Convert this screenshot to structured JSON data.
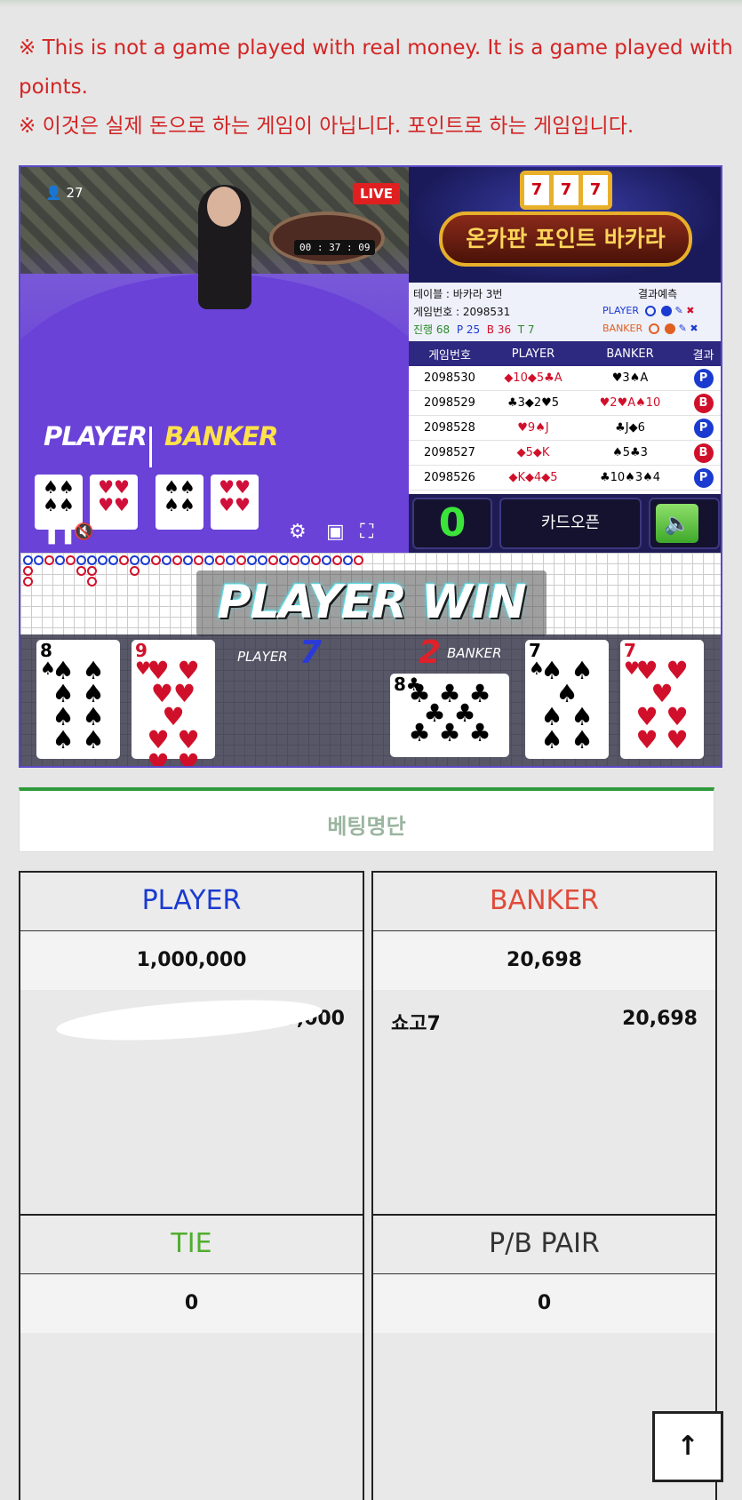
{
  "notice": {
    "line1": "※ This is not a game played with real money. It is a game played with",
    "line2": "points.",
    "line3": "※ 이것은 실제 돈으로 하는 게임이 아닙니다. 포인트로 하는 게임입니다."
  },
  "video": {
    "viewers": "27",
    "live_label": "LIVE",
    "timer": "00 : 37 : 09",
    "player_label": "PLAYER",
    "banker_label": "BANKER"
  },
  "board": {
    "logo": "온카판 포인트 바카라",
    "slot": [
      "7",
      "7",
      "7"
    ],
    "table_label": "테이블 : 바카라 3번",
    "game_no_label": "게임번호 : 2098531",
    "progress_label": "진행 68",
    "p_count": "P 25",
    "b_count": "B 36",
    "t_count": "T 7",
    "prediction_label": "결과예측",
    "pred_player": "PLAYER",
    "pred_banker": "BANKER",
    "history_headers": [
      "게임번호",
      "PLAYER",
      "BANKER",
      "결과"
    ],
    "history": [
      {
        "no": "2098530",
        "player": "◆10◆5♣A",
        "banker": "♥3♠A",
        "result": "P"
      },
      {
        "no": "2098529",
        "player": "♣3◆2♥5",
        "banker": "♥2♥A♠10",
        "result": "B"
      },
      {
        "no": "2098528",
        "player": "♥9♠J",
        "banker": "♣J◆6",
        "result": "P"
      },
      {
        "no": "2098527",
        "player": "◆5◆K",
        "banker": "♠5♣3",
        "result": "B"
      },
      {
        "no": "2098526",
        "player": "◆K◆4◆5",
        "banker": "♣10♠3♠4",
        "result": "P"
      }
    ],
    "counter": "0",
    "card_open_label": "카드오픈",
    "sound_icon": "speaker-icon"
  },
  "result": {
    "win_text": "PLAYER WIN",
    "player_label": "PLAYER",
    "player_score": "7",
    "banker_label": "BANKER",
    "banker_score": "2",
    "player_cards": [
      {
        "rank": "8",
        "suit": "♠",
        "color": "#000000"
      },
      {
        "rank": "9",
        "suit": "♥",
        "color": "#d0102a"
      }
    ],
    "banker_cards": [
      {
        "rank": "8",
        "suit": "♣",
        "color": "#000000"
      },
      {
        "rank": "7",
        "suit": "♠",
        "color": "#000000"
      },
      {
        "rank": "7",
        "suit": "♥",
        "color": "#d0102a"
      }
    ]
  },
  "betting": {
    "title": "베팅명단",
    "player": {
      "label": "PLAYER",
      "color": "#1a3ad0",
      "total": "1,000,000",
      "entry_amount": "1,000,000"
    },
    "banker": {
      "label": "BANKER",
      "color": "#e04a3a",
      "total": "20,698",
      "entry_name": "쇼고7",
      "entry_amount": "20,698"
    },
    "tie": {
      "label": "TIE",
      "color": "#4fae2e",
      "total": "0"
    },
    "pair": {
      "label": "P/B PAIR",
      "color": "#333333",
      "total": "0"
    }
  },
  "scroll_top_icon": "arrow-up-icon",
  "colors": {
    "accent_green": "#2e9a3a",
    "notice_red": "#d32424",
    "board_purple": "#2d2880"
  }
}
